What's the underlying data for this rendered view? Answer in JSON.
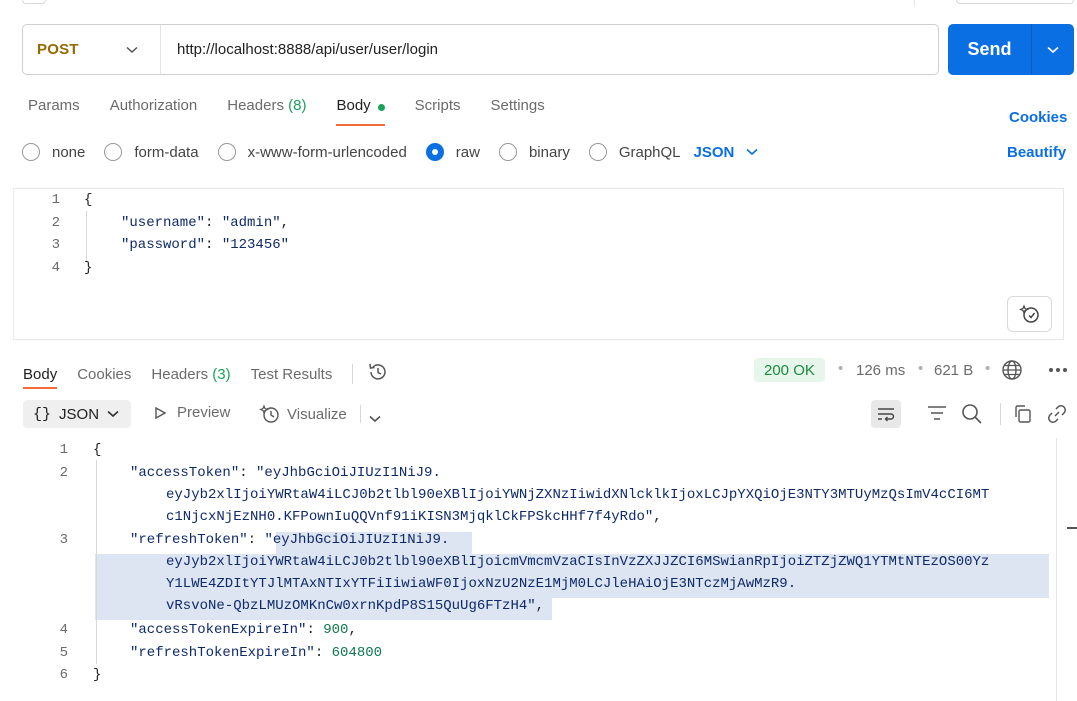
{
  "request": {
    "method": "POST",
    "url": "http://localhost:8888/api/user/user/login",
    "send_label": "Send",
    "tabs": [
      {
        "label": "Params"
      },
      {
        "label": "Authorization"
      },
      {
        "label": "Headers",
        "count": "(8)"
      },
      {
        "label": "Body",
        "active": true
      },
      {
        "label": "Scripts"
      },
      {
        "label": "Settings"
      }
    ],
    "cookies_label": "Cookies",
    "beautify_label": "Beautify",
    "body_types": [
      "none",
      "form-data",
      "x-www-form-urlencoded",
      "raw",
      "binary",
      "GraphQL"
    ],
    "selected_body_type": "raw",
    "language": "JSON",
    "editor_lines": [
      {
        "num": "1",
        "text": "{"
      },
      {
        "num": "2",
        "key": "\"username\"",
        "value": "\"admin\"",
        "suffix": ","
      },
      {
        "num": "3",
        "key": "\"password\"",
        "value": "\"123456\"",
        "suffix": ""
      },
      {
        "num": "4",
        "text": "}"
      }
    ]
  },
  "response": {
    "tabs": [
      {
        "label": "Body",
        "active": true
      },
      {
        "label": "Cookies"
      },
      {
        "label": "Headers",
        "count": "(3)"
      },
      {
        "label": "Test Results"
      }
    ],
    "status": "200 OK",
    "time": "126 ms",
    "size": "621 B",
    "format": "JSON",
    "preview_label": "Preview",
    "visualize_label": "Visualize",
    "lines": {
      "l1": "{",
      "l2_key": "\"accessToken\"",
      "l2_v1": "\"eyJhbGciOiJIUzI1NiJ9.",
      "l2_v2": "eyJyb2xlIjoiYWRtaW4iLCJ0b2tlbl90eXBlIjoiYWNjZXNzIiwidXNlcklkIjoxLCJpYXQiOjE3NTY3MTUyMzQsImV4cCI6MT",
      "l2_v3": "c1NjcxNjEzNH0.KFPownIuQQVnf91iKISN3MjqklCkFPSkcHHf7f4yRdo\"",
      "l3_key": "\"refreshToken\"",
      "l3_v1": "\"eyJhbGciOiJIUzI1NiJ9.",
      "l3_v2": "eyJyb2xlIjoiYWRtaW4iLCJ0b2tlbl90eXBlIjoicmVmcmVzaCIsInVzZXJJZCI6MSwianRpIjoiZTZjZWQ1YTMtNTEzOS00Yz",
      "l3_v3": "Y1LWE4ZDItYTJlMTAxNTIxYTFiIiwiaWF0IjoxNzU2NzE1MjM0LCJleHAiOjE3NTczMjAwMzR9.",
      "l3_v4": "vRsvoNe-QbzLMUzOMKnCw0xrnKpdP8S15QuUg6FTzH4\"",
      "l4_key": "\"accessTokenExpireIn\"",
      "l4_val": "900",
      "l5_key": "\"refreshTokenExpireIn\"",
      "l5_val": "604800",
      "l6": "}"
    },
    "line_numbers": [
      "1",
      "2",
      "3",
      "4",
      "5",
      "6"
    ]
  },
  "colors": {
    "accent_blue": "#0b6fe4",
    "method_post": "#946b00",
    "active_tab_underline": "#f26b3a",
    "status_ok": "#1a8a3e"
  }
}
